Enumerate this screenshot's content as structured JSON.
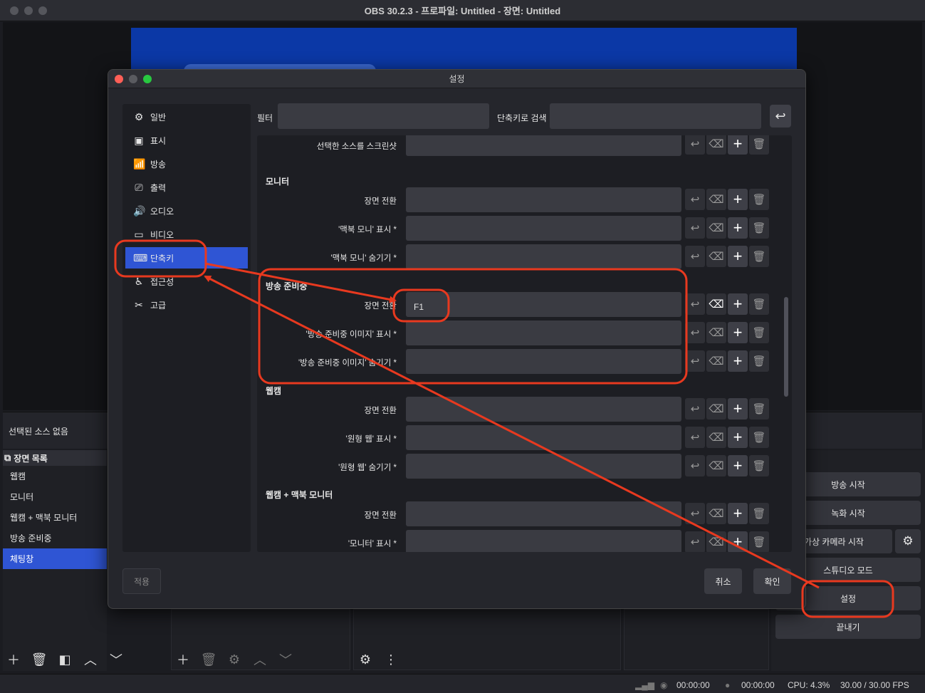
{
  "window": {
    "title": "OBS 30.2.3 - 프로파일: Untitled - 장면: Untitled"
  },
  "sources": {
    "empty_text": "선택된 소스 없음"
  },
  "scenes": {
    "header": "장면 목록",
    "items": [
      "웹캠",
      "모니터",
      "웹캠 + 맥북 모니터",
      "방송 준비중",
      "체팅창"
    ]
  },
  "controls": {
    "start_stream": "방송 시작",
    "start_record": "녹화 시작",
    "virtual_cam": "가상 카메라 시작",
    "studio_mode": "스튜디오 모드",
    "settings": "설정",
    "exit": "끝내기"
  },
  "status": {
    "time1": "00:00:00",
    "time2": "00:00:00",
    "cpu": "CPU: 4.3%",
    "fps": "30.00 / 30.00 FPS"
  },
  "dialog": {
    "title": "설정",
    "sidebar": [
      {
        "label": "일반",
        "icon": "gear-icon"
      },
      {
        "label": "표시",
        "icon": "display-icon"
      },
      {
        "label": "방송",
        "icon": "antenna-icon"
      },
      {
        "label": "출력",
        "icon": "output-icon"
      },
      {
        "label": "오디오",
        "icon": "speaker-icon"
      },
      {
        "label": "비디오",
        "icon": "monitor-icon"
      },
      {
        "label": "단축키",
        "icon": "keyboard-icon"
      },
      {
        "label": "접근성",
        "icon": "accessibility-icon"
      },
      {
        "label": "고급",
        "icon": "tools-icon"
      }
    ],
    "filter_label": "필터",
    "search_label": "단축키로 검색",
    "rows": [
      {
        "label": "선택한 소스를 스크린샷",
        "value": ""
      },
      {
        "label": "장면 전환",
        "value": ""
      },
      {
        "label": "'맥북 모니' 표시 *",
        "value": ""
      },
      {
        "label": "'맥북 모니' 숨기기 *",
        "value": ""
      },
      {
        "label": "장면 전환",
        "value": "F1"
      },
      {
        "label": "'방송 준비중 이미지' 표시 *",
        "value": ""
      },
      {
        "label": "'방송 준비중 이미지' 숨기기 *",
        "value": ""
      },
      {
        "label": "장면 전환",
        "value": ""
      },
      {
        "label": "'원형 웹' 표시 *",
        "value": ""
      },
      {
        "label": "'원형 웹' 숨기기 *",
        "value": ""
      },
      {
        "label": "장면 전환",
        "value": ""
      },
      {
        "label": "'모니터' 표시 *",
        "value": ""
      }
    ],
    "sections": [
      "모니터",
      "방송 준비중",
      "웹캠",
      "웹캠 + 맥북 모니터"
    ],
    "apply": "적용",
    "cancel": "취소",
    "ok": "확인"
  },
  "colors": {
    "accent": "#2f55d4",
    "annotation": "#e8391f"
  }
}
